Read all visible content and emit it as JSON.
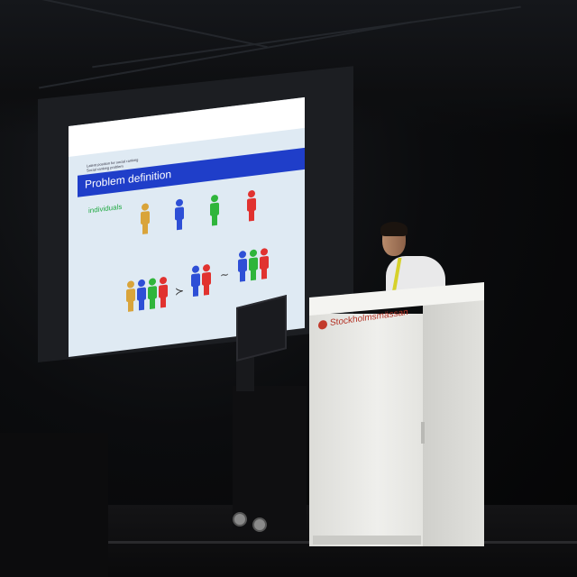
{
  "slide": {
    "breadcrumb_line1": "Latent position for social ranking",
    "breadcrumb_line2": "Social ranking problem",
    "title": "Problem definition",
    "label": "individuals",
    "operator_1": "≻",
    "operator_2": "~"
  },
  "podium": {
    "sign": "Stockholmsmässan"
  },
  "colors": {
    "slide_title_bar": "#1f3ec9",
    "slide_background": "#dfeaf3",
    "figure_orange": "#d9a43a",
    "figure_blue": "#2e4fd6",
    "figure_green": "#2fb53b",
    "figure_red": "#e1322f",
    "podium_accent": "#c23b2c"
  }
}
